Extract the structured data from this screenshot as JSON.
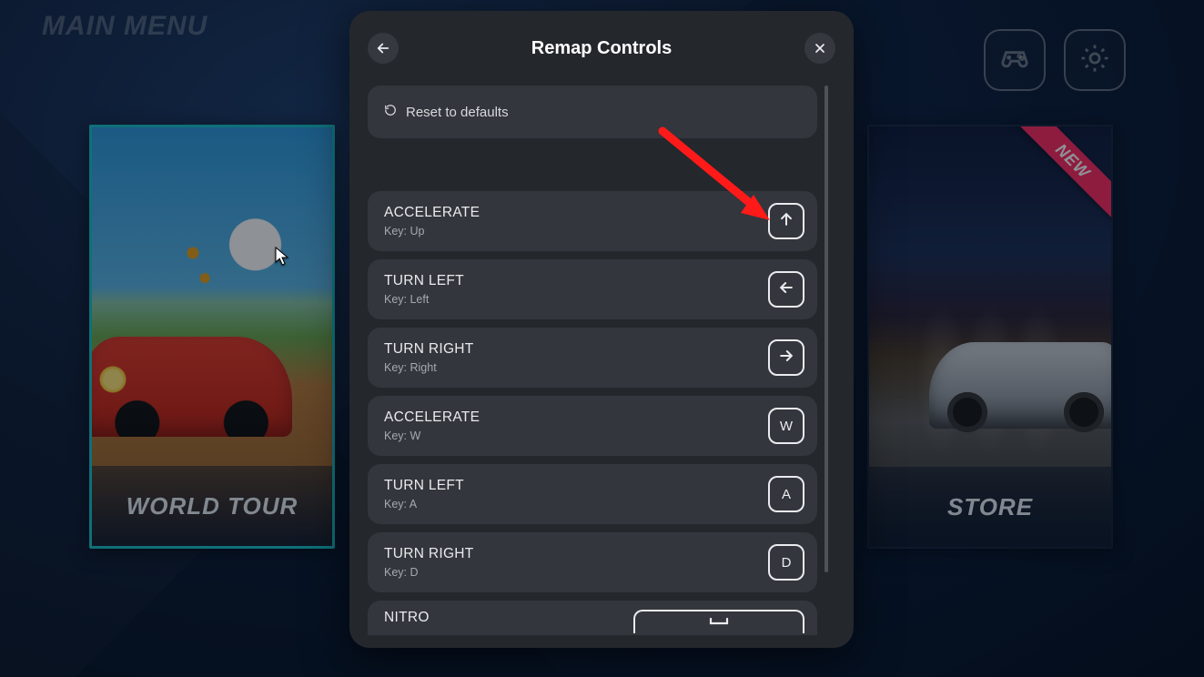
{
  "header": {
    "main_menu": "MAIN MENU"
  },
  "cards": {
    "left": {
      "label": "WORLD TOUR"
    },
    "right": {
      "label": "STORE",
      "ribbon": "NEW"
    }
  },
  "modal": {
    "title": "Remap Controls",
    "reset_label": "Reset to defaults",
    "controls": [
      {
        "name": "ACCELERATE",
        "key_label": "Key: Up",
        "cap_type": "arrow-up"
      },
      {
        "name": "TURN LEFT",
        "key_label": "Key: Left",
        "cap_type": "arrow-left"
      },
      {
        "name": "TURN RIGHT",
        "key_label": "Key: Right",
        "cap_type": "arrow-right"
      },
      {
        "name": "ACCELERATE",
        "key_label": "Key: W",
        "cap_type": "text",
        "cap_text": "W"
      },
      {
        "name": "TURN LEFT",
        "key_label": "Key: A",
        "cap_type": "text",
        "cap_text": "A"
      },
      {
        "name": "TURN RIGHT",
        "key_label": "Key: D",
        "cap_type": "text",
        "cap_text": "D"
      },
      {
        "name": "NITRO",
        "key_label": "",
        "cap_type": "space"
      }
    ]
  }
}
